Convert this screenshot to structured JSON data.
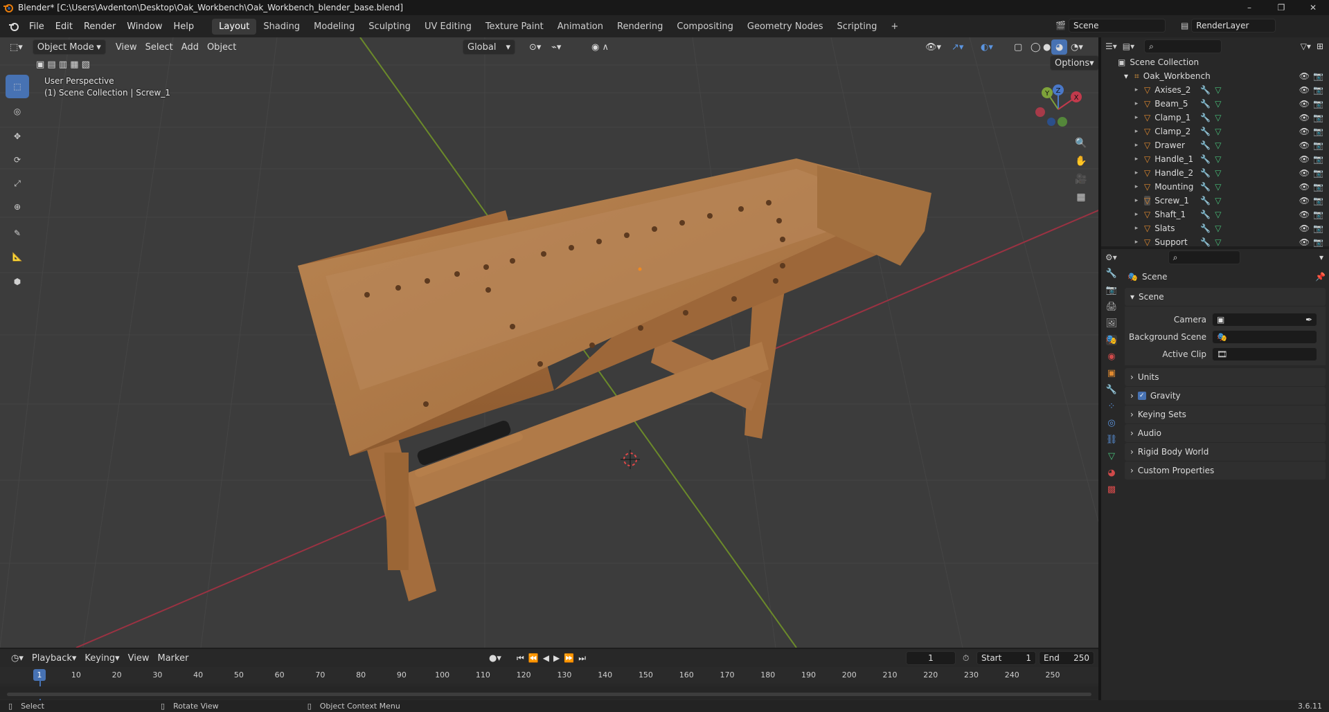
{
  "titlebar": {
    "title": "Blender* [C:\\Users\\Avdenton\\Desktop\\Oak_Workbench\\Oak_Workbench_blender_base.blend]",
    "minimize": "–",
    "maximize": "❐",
    "close": "✕"
  },
  "menu": [
    "File",
    "Edit",
    "Render",
    "Window",
    "Help"
  ],
  "workspaces": [
    "Layout",
    "Shading",
    "Modeling",
    "Sculpting",
    "UV Editing",
    "Texture Paint",
    "Animation",
    "Rendering",
    "Compositing",
    "Geometry Nodes",
    "Scripting"
  ],
  "workspace_add": "+",
  "scene_selector": {
    "value": "Scene"
  },
  "view_layer": {
    "value": "RenderLayer"
  },
  "viewport_header": {
    "mode": "Object Mode",
    "menus": [
      "View",
      "Select",
      "Add",
      "Object"
    ],
    "orientation": "Global",
    "options": "Options"
  },
  "viewport_overlay": {
    "perspective": "User Perspective",
    "collection": "(1) Scene Collection | Screw_1"
  },
  "gizmo": {
    "x": "X",
    "y": "Y",
    "z": "Z"
  },
  "outliner": {
    "root": "Scene Collection",
    "collection": "Oak_Workbench",
    "objects": [
      {
        "name": "Axises_2",
        "selected": false
      },
      {
        "name": "Beam_5",
        "selected": false
      },
      {
        "name": "Clamp_1",
        "selected": false
      },
      {
        "name": "Clamp_2",
        "selected": false
      },
      {
        "name": "Drawer",
        "selected": false
      },
      {
        "name": "Handle_1",
        "selected": false
      },
      {
        "name": "Handle_2",
        "selected": false
      },
      {
        "name": "Mounting",
        "selected": false
      },
      {
        "name": "Screw_1",
        "selected": true
      },
      {
        "name": "Shaft_1",
        "selected": false
      },
      {
        "name": "Slats",
        "selected": false
      },
      {
        "name": "Support",
        "selected": false
      }
    ]
  },
  "properties": {
    "context": "Scene",
    "panel": "Scene",
    "fields": [
      {
        "label": "Camera",
        "value": ""
      },
      {
        "label": "Background Scene",
        "value": ""
      },
      {
        "label": "Active Clip",
        "value": ""
      }
    ],
    "sections": [
      {
        "label": "Units",
        "checkbox": false
      },
      {
        "label": "Gravity",
        "checkbox": true
      },
      {
        "label": "Keying Sets",
        "checkbox": false
      },
      {
        "label": "Audio",
        "checkbox": false
      },
      {
        "label": "Rigid Body World",
        "checkbox": false
      },
      {
        "label": "Custom Properties",
        "checkbox": false
      }
    ]
  },
  "timeline": {
    "menus": [
      "Playback",
      "Keying",
      "View",
      "Marker"
    ],
    "current_frame": "1",
    "start_label": "Start",
    "start": "1",
    "end_label": "End",
    "end": "250",
    "ruler": [
      "10",
      "20",
      "30",
      "40",
      "50",
      "60",
      "70",
      "80",
      "90",
      "100",
      "110",
      "120",
      "130",
      "140",
      "150",
      "160",
      "170",
      "180",
      "190",
      "200",
      "210",
      "220",
      "230",
      "240",
      "250"
    ],
    "playhead": "1"
  },
  "status": {
    "select": "Select",
    "rotate": "Rotate View",
    "context": "Object Context Menu",
    "version": "3.6.11"
  },
  "colors": {
    "accent": "#4772b3",
    "selected_row": "#334d80",
    "x_axis": "#b33a4a",
    "y_axis": "#7ea23a",
    "wood": "#b07a48"
  }
}
